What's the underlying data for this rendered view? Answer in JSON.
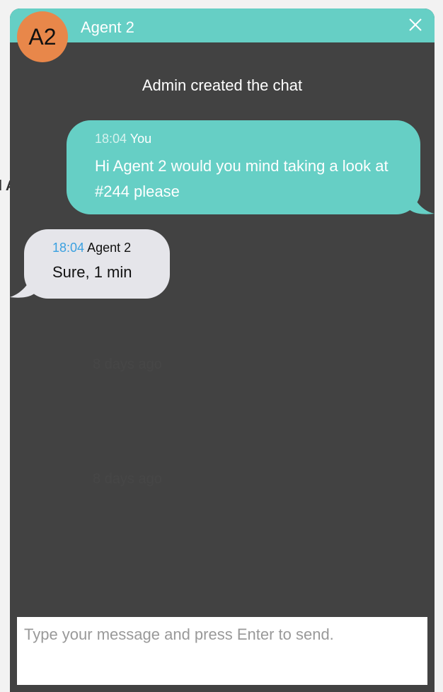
{
  "background": {
    "activity_label": "ll Activity",
    "timestamps": [
      "8 days ago",
      "8 days ago"
    ]
  },
  "chat": {
    "avatar_initials": "A2",
    "avatar_color": "#e8874a",
    "header_title": "Agent 2",
    "header_color": "#66cfc5",
    "close_icon": "close-icon",
    "system_message": "Admin created the chat",
    "messages": [
      {
        "direction": "outgoing",
        "time": "18:04",
        "author": "You",
        "text": "Hi Agent 2 would you mind taking a look at #244 please"
      },
      {
        "direction": "incoming",
        "time": "18:04",
        "author": "Agent 2",
        "text": "Sure, 1 min"
      }
    ],
    "input": {
      "value": "",
      "placeholder": "Type your message and press Enter to send."
    }
  }
}
